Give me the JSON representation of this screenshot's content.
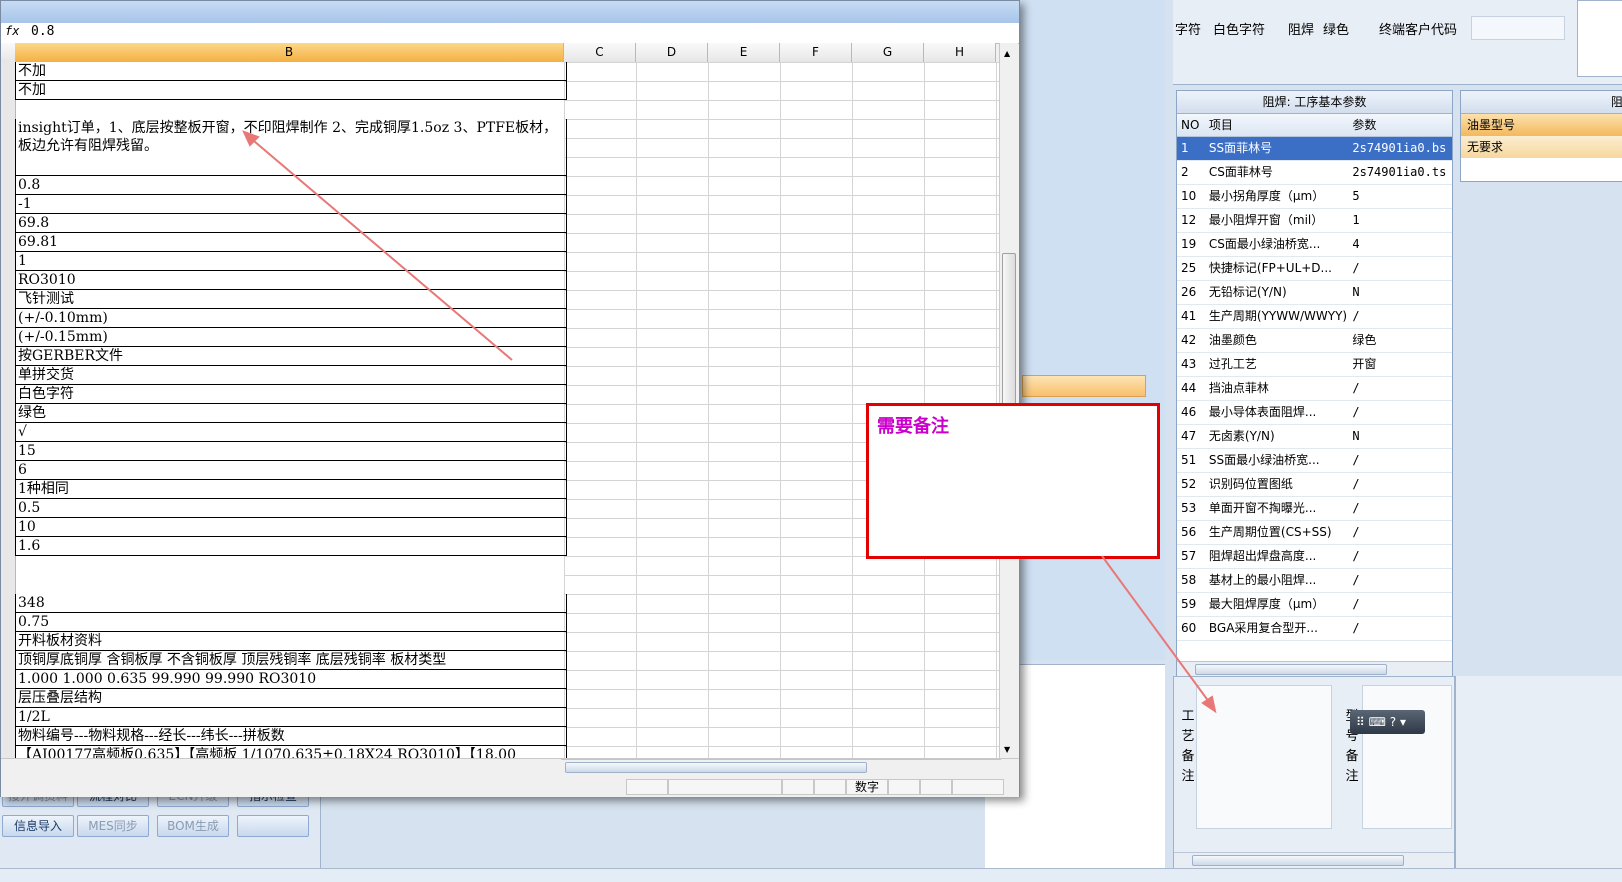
{
  "formula_bar": {
    "fx_icon": "fx",
    "value": "0.8"
  },
  "columns": [
    "B",
    "C",
    "D",
    "E",
    "F",
    "G",
    "H"
  ],
  "cells": [
    {
      "row": 0,
      "text": "不加"
    },
    {
      "row": 1,
      "text": "不加"
    },
    {
      "row": 3,
      "text": "insight订单，1、底层按整板开窗，不印阻焊制作  2、完成铜厚1.5oz  3、PTFE板材，",
      "text2": "板边允许有阻焊残留。"
    },
    {
      "row": 4,
      "text": "0.8"
    },
    {
      "row": 5,
      "text": "-1"
    },
    {
      "row": 6,
      "text": "69.8"
    },
    {
      "row": 7,
      "text": "69.81"
    },
    {
      "row": 8,
      "text": "1"
    },
    {
      "row": 9,
      "text": "RO3010"
    },
    {
      "row": 10,
      "text": "飞针测试"
    },
    {
      "row": 11,
      "text": "(+/-0.10mm)"
    },
    {
      "row": 12,
      "text": "(+/-0.15mm)"
    },
    {
      "row": 13,
      "text": "按GERBER文件"
    },
    {
      "row": 14,
      "text": "单拼交货"
    },
    {
      "row": 15,
      "text": "白色字符"
    },
    {
      "row": 16,
      "text": "绿色"
    },
    {
      "row": 17,
      "text": "√"
    },
    {
      "row": 18,
      "text": "15"
    },
    {
      "row": 19,
      "text": "6"
    },
    {
      "row": 20,
      "text": "1种相同"
    },
    {
      "row": 21,
      "text": "0.5"
    },
    {
      "row": 22,
      "text": "10"
    },
    {
      "row": 23,
      "text": "1.6"
    },
    {
      "row": 26,
      "text": "348"
    },
    {
      "row": 27,
      "text": "0.75"
    },
    {
      "row": 28,
      "text": "开料板材资料"
    },
    {
      "row": 29,
      "text": "顶铜厚底铜厚 含铜板厚 不含铜板厚 顶层残铜率 底层残铜率 板材类型"
    },
    {
      "row": 30,
      "text": "1.000  1.000         0.635        99.990     99.990       RO3010"
    },
    {
      "row": 31,
      "text": "层压叠层结构"
    },
    {
      "row": 32,
      "text": "1/2L"
    },
    {
      "row": 33,
      "text": "物料编号---物料规格---经长---纬长---拼板数"
    },
    {
      "row": 34,
      "text": "【AI00177高频板0.635】【高频板 1/1070.635±0.18X24    RO3010】【18.00"
    }
  ],
  "excel_status": {
    "num_mode": "数字"
  },
  "callout": {
    "text": "需要备注"
  },
  "top_right": {
    "labels": [
      "字符",
      "白色字符",
      "阻焊",
      "绿色",
      "终端客户代码"
    ]
  },
  "param_grid": {
    "title": "阻焊: 工序基本参数",
    "headers": [
      "NO",
      "项目",
      "参数"
    ],
    "rows": [
      [
        "1",
        "SS面菲林号",
        "2s74901ia0.bs"
      ],
      [
        "2",
        "CS面菲林号",
        "2s74901ia0.ts"
      ],
      [
        "10",
        "最小拐角厚度（μm）",
        "5"
      ],
      [
        "12",
        "最小阻焊开窗（mil）",
        "1"
      ],
      [
        "19",
        "CS面最小绿油桥宽...",
        "4"
      ],
      [
        "25",
        "快捷标记(FP+UL+D...",
        "/"
      ],
      [
        "26",
        "无铅标记(Y/N)",
        "N"
      ],
      [
        "41",
        "生产周期(YYWW/WWYY)",
        "/"
      ],
      [
        "42",
        "油墨颜色",
        "绿色"
      ],
      [
        "43",
        "过孔工艺",
        "开窗"
      ],
      [
        "44",
        "挡油点菲林",
        "/"
      ],
      [
        "46",
        "最小导体表面阻焊...",
        "/"
      ],
      [
        "47",
        "无卤素(Y/N)",
        "N"
      ],
      [
        "51",
        "SS面最小绿油桥宽...",
        "/"
      ],
      [
        "52",
        "识别码位置图纸",
        "/"
      ],
      [
        "53",
        "单面开窗不掏曝光...",
        "/"
      ],
      [
        "56",
        "生产周期位置(CS+SS)",
        "/"
      ],
      [
        "57",
        "阻焊超出焊盘高度...",
        "/"
      ],
      [
        "58",
        "基材上的最小阻焊...",
        "/"
      ],
      [
        "59",
        "最大阻焊厚度（μm）",
        "/"
      ],
      [
        "60",
        "BGA采用复合型开...",
        "/"
      ]
    ]
  },
  "ink_grid": {
    "title": "阻",
    "header": "油墨型号",
    "row": "无要求"
  },
  "notes": {
    "label1": "工艺备注",
    "label2": "型号备注"
  },
  "bottom_buttons": [
    {
      "label": "接外调资料",
      "dim": true
    },
    {
      "label": "流程对比",
      "dim": false
    },
    {
      "label": "ECN升级",
      "dim": true
    },
    {
      "label": "指示检查",
      "dim": false
    },
    {
      "label": "信息导入",
      "dim": false
    },
    {
      "label": "MES同步",
      "dim": true
    },
    {
      "label": "BOM生成",
      "dim": true
    },
    {
      "label": "",
      "dim": false
    }
  ],
  "colors": {
    "accent": "#3b6fc5",
    "callout_border": "#e30000",
    "callout_text": "#cc00cc",
    "arrow": "#e87878"
  }
}
